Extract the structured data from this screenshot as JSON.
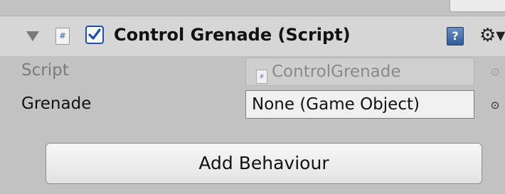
{
  "component": {
    "title": "Control Grenade (Script)",
    "enabled": true,
    "icon": "csharp-script-icon",
    "help_icon": "help-book-icon",
    "settings_icon": "gear-icon"
  },
  "properties": {
    "script": {
      "label": "Script",
      "value": "ControlGrenade",
      "icon": "script-asset-icon",
      "picker_icon": "object-picker-icon"
    },
    "grenade": {
      "label": "Grenade",
      "value": "None (Game Object)",
      "picker_icon": "object-picker-icon"
    }
  },
  "add_button": {
    "label": "Add Behaviour"
  },
  "colors": {
    "accent": "#1b4fb3",
    "panel": "#c2c2c2",
    "header": "#d6d6d6"
  }
}
